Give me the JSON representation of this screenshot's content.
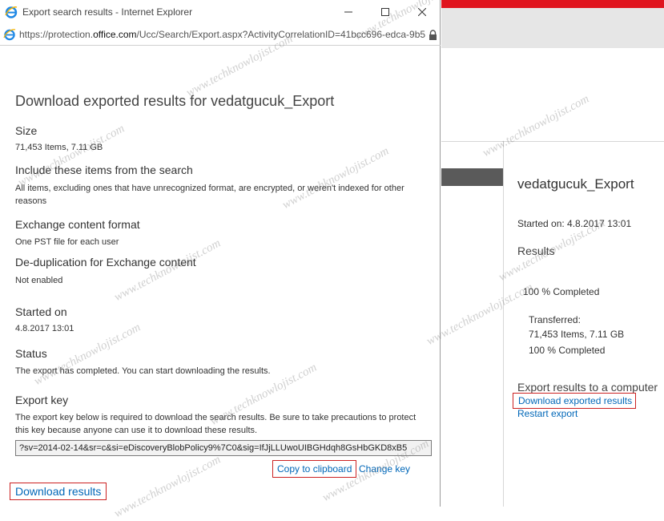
{
  "window": {
    "title": "Export search results - Internet Explorer",
    "url_prefix": "https://protection.",
    "url_domain": "office.com",
    "url_rest": "/Ucc/Search/Export.aspx?ActivityCorrelationID=41bcc696-edca-9b5"
  },
  "dialog": {
    "heading": "Download exported results for vedatgucuk_Export",
    "sections": [
      {
        "label": "Size",
        "value": "71,453 Items, 7.11 GB"
      },
      {
        "label": "Include these items from the search",
        "value": "All items, excluding ones that have unrecognized format, are encrypted, or weren't indexed for other reasons"
      },
      {
        "label": "Exchange content format",
        "value": "One PST file for each user"
      },
      {
        "label": "De-duplication for Exchange content",
        "value": "Not enabled"
      },
      {
        "label": "Started on",
        "value": "4.8.2017 13:01"
      },
      {
        "label": "Status",
        "value": "The export has completed. You can start downloading the results."
      },
      {
        "label": "Export key",
        "value": "The export key below is required to download the search results. Be sure to take precautions to protect this key because anyone can use it to download these results."
      }
    ],
    "export_key_value": "?sv=2014-02-14&sr=c&si=eDiscoveryBlobPolicy9%7C0&sig=IfJjLLUwoUIBGHdqh8GsHbGKD8xB5",
    "copy_label": "Copy to clipboard",
    "change_key_label": "Change key",
    "download_label": "Download results"
  },
  "side_panel": {
    "title": "vedatgucuk_Export",
    "started": "Started on: 4.8.2017 13:01",
    "results_heading": "Results",
    "percent_completed": "100 % Completed",
    "transferred_label": "Transferred:",
    "transferred_items": "71,453 Items, 7.11 GB",
    "transferred_percent": "100 % Completed",
    "export_heading": "Export results to a computer",
    "download_link": "Download exported results",
    "restart_link": "Restart export"
  },
  "watermark": "www.techknowlojist.com",
  "colors": {
    "accent_red": "#e0141e",
    "link_blue": "#0067b8",
    "highlight_border": "#cc2222"
  }
}
